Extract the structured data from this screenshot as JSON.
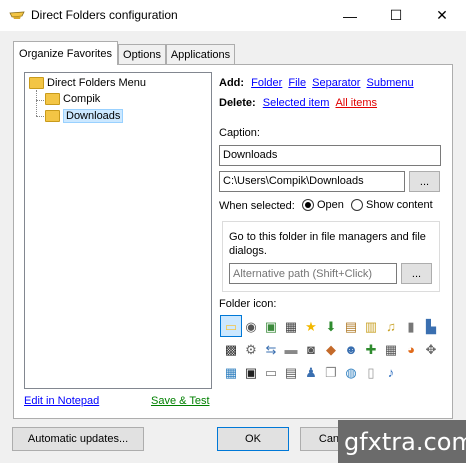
{
  "window": {
    "title": "Direct Folders configuration",
    "minimize_glyph": "—",
    "maximize_glyph": "☐",
    "close_glyph": "✕"
  },
  "tabs": [
    {
      "label": "Organize Favorites",
      "active": true
    },
    {
      "label": "Options",
      "active": false
    },
    {
      "label": "Applications",
      "active": false
    }
  ],
  "tree": {
    "root": "Direct Folders Menu",
    "children": [
      {
        "label": "Compik",
        "selected": false
      },
      {
        "label": "Downloads",
        "selected": true
      }
    ]
  },
  "add": {
    "label": "Add:",
    "links": [
      "Folder",
      "File",
      "Separator",
      "Submenu"
    ]
  },
  "delete": {
    "label": "Delete:",
    "selected_item": "Selected item",
    "all_items": "All items"
  },
  "caption": {
    "label": "Caption:",
    "value": "Downloads"
  },
  "path": {
    "value": "C:\\Users\\Compik\\Downloads",
    "browse_label": "..."
  },
  "when_selected": {
    "label": "When selected:",
    "options": [
      {
        "label": "Open",
        "checked": true
      },
      {
        "label": "Show content",
        "checked": false
      }
    ]
  },
  "alt_path": {
    "description": "Go to this folder in file managers and file dialogs.",
    "placeholder": "Alternative path (Shift+Click)",
    "browse_label": "..."
  },
  "folder_icon": {
    "label": "Folder icon:",
    "icons": [
      {
        "name": "folder-icon",
        "glyph": "▭",
        "color": "#f3c545"
      },
      {
        "name": "speaker-icon",
        "glyph": "◉",
        "color": "#555555"
      },
      {
        "name": "picture-icon",
        "glyph": "▣",
        "color": "#3b8a3b"
      },
      {
        "name": "video-icon",
        "glyph": "▦",
        "color": "#444444"
      },
      {
        "name": "star-icon",
        "glyph": "★",
        "color": "#f2b800"
      },
      {
        "name": "download-icon",
        "glyph": "⬇",
        "color": "#2e8b2e"
      },
      {
        "name": "book-icon",
        "glyph": "▤",
        "color": "#b07b2a"
      },
      {
        "name": "documents-icon",
        "glyph": "▥",
        "color": "#c9a227"
      },
      {
        "name": "music-folder-icon",
        "glyph": "♫",
        "color": "#c9a227"
      },
      {
        "name": "phone-icon",
        "glyph": "▮",
        "color": "#777777"
      },
      {
        "name": "devices-icon",
        "glyph": "▙",
        "color": "#3a6fb0"
      },
      {
        "name": "film-icon",
        "glyph": "▩",
        "color": "#333333"
      },
      {
        "name": "gears-icon",
        "glyph": "⚙",
        "color": "#666666"
      },
      {
        "name": "network-icon",
        "glyph": "⇆",
        "color": "#3a6fb0"
      },
      {
        "name": "drive-icon",
        "glyph": "▬",
        "color": "#888888"
      },
      {
        "name": "camera-icon",
        "glyph": "◙",
        "color": "#555555"
      },
      {
        "name": "box-icon",
        "glyph": "◆",
        "color": "#c46a2a"
      },
      {
        "name": "users-icon",
        "glyph": "☻",
        "color": "#3a6fb0"
      },
      {
        "name": "plus-icon",
        "glyph": "✚",
        "color": "#2e8b2e"
      },
      {
        "name": "calculator-icon",
        "glyph": "▦",
        "color": "#555555"
      },
      {
        "name": "chart-icon",
        "glyph": "◕",
        "color": "#e06a1a"
      },
      {
        "name": "gamepad-icon",
        "glyph": "✥",
        "color": "#666666"
      },
      {
        "name": "grid-icon",
        "glyph": "▦",
        "color": "#2f7fbf"
      },
      {
        "name": "terminal-icon",
        "glyph": "▣",
        "color": "#222222"
      },
      {
        "name": "keyboard-icon",
        "glyph": "▭",
        "color": "#777777"
      },
      {
        "name": "printer-icon",
        "glyph": "▤",
        "color": "#555555"
      },
      {
        "name": "person-icon",
        "glyph": "♟",
        "color": "#3a6fb0"
      },
      {
        "name": "copy-icon",
        "glyph": "❐",
        "color": "#888888"
      },
      {
        "name": "globe-icon",
        "glyph": "◍",
        "color": "#2f7fbf"
      },
      {
        "name": "page-icon",
        "glyph": "▯",
        "color": "#999999"
      },
      {
        "name": "note-icon",
        "glyph": "♪",
        "color": "#2f6fbf"
      }
    ]
  },
  "footer_links": {
    "edit": "Edit in Notepad",
    "save": "Save & Test"
  },
  "buttons": {
    "updates": "Automatic updates...",
    "ok": "OK",
    "cancel": "Cancel"
  },
  "watermark": "gfxtra.com"
}
